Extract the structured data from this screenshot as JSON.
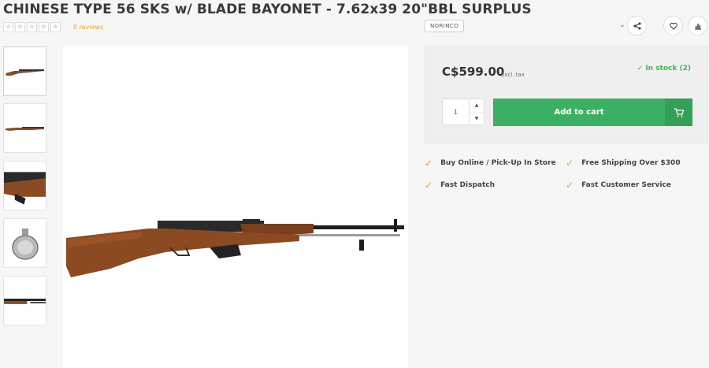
{
  "product": {
    "title": "CHINESE TYPE 56 SKS w/ BLADE BAYONET - 7.62x39 20\"BBL SURPLUS",
    "reviews_label": "0 reviews",
    "brand": "NORINCO",
    "rating_stars": 0
  },
  "icons": {
    "share": "share-icon",
    "wishlist": "heart-icon",
    "compare": "bar-chart-icon",
    "dropdown": "chevron-down-icon",
    "cart": "cart-icon",
    "check": "check-icon"
  },
  "purchase": {
    "price": "C$599.00",
    "tax_note": "Excl. tax",
    "stock_status": "In stock (2)",
    "quantity": "1",
    "add_to_cart_label": "Add to cart"
  },
  "usps": [
    {
      "label": "Buy Online / Pick-Up In Store"
    },
    {
      "label": "Free Shipping Over $300"
    },
    {
      "label": "Fast Dispatch"
    },
    {
      "label": "Fast Customer Service"
    }
  ],
  "colors": {
    "accent_green": "#3cb062",
    "stock_green": "#4caf50",
    "check_orange": "#e6a23c"
  }
}
